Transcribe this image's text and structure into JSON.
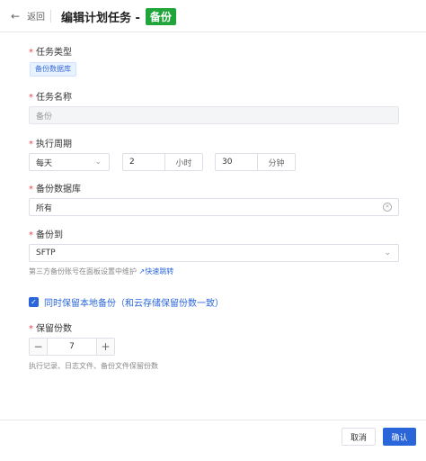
{
  "header": {
    "back_label": "返回",
    "title": "编辑计划任务 -",
    "title_tag": "备份"
  },
  "form": {
    "task_type": {
      "label": "任务类型",
      "value": "备份数据库"
    },
    "task_name": {
      "label": "任务名称",
      "placeholder": "备份"
    },
    "period": {
      "label": "执行周期",
      "frequency": "每天",
      "hours": "2",
      "hours_unit": "小时",
      "minutes": "30",
      "minutes_unit": "分钟"
    },
    "database": {
      "label": "备份数据库",
      "value": "所有"
    },
    "destination": {
      "label": "备份到",
      "value": "SFTP",
      "hint": "第三方备份账号在面板设置中维护",
      "hint_link": "快速跳转"
    },
    "keep_local": {
      "label": "同时保留本地备份（和云存储保留份数一致）",
      "checked": true
    },
    "retain": {
      "label": "保留份数",
      "value": "7",
      "hint": "执行记录、日志文件、备份文件保留份数"
    }
  },
  "footer": {
    "cancel_label": "取消",
    "confirm_label": "确认"
  },
  "colors": {
    "accent": "#2a66d9",
    "tag_green": "#20a53a",
    "required": "#e5484d"
  }
}
